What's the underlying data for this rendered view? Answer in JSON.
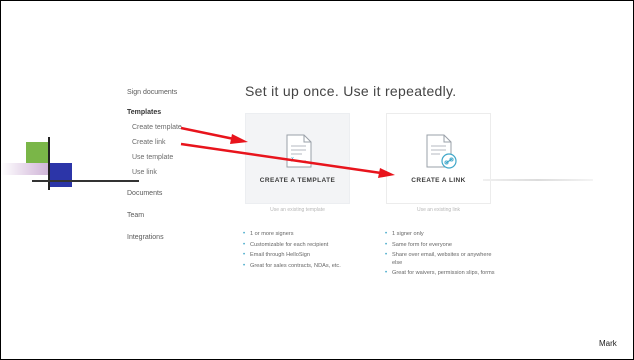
{
  "sidebar": {
    "sign_documents": "Sign documents",
    "templates": "Templates",
    "create_template": "Create template",
    "create_link": "Create link",
    "use_template": "Use template",
    "use_link": "Use link",
    "documents": "Documents",
    "team": "Team",
    "integrations": "Integrations"
  },
  "main": {
    "headline": "Set it up once. Use it repeatedly.",
    "template_card": {
      "label": "CREATE A TEMPLATE",
      "sub": "Use an existing template",
      "bullets": [
        "1 or more signers",
        "Customizable for each recipient",
        "Email through HelloSign",
        "Great for sales contracts, NDAs, etc."
      ]
    },
    "link_card": {
      "label": "CREATE A LINK",
      "sub": "Use an existing link",
      "bullets": [
        "1 signer only",
        "Same form for everyone",
        "Share over email, websites or anywhere else",
        "Great for waivers, permission slips, forms"
      ]
    }
  },
  "annotations": {
    "arrow_color": "#e8141c"
  },
  "footer": {
    "author": "Mark"
  }
}
